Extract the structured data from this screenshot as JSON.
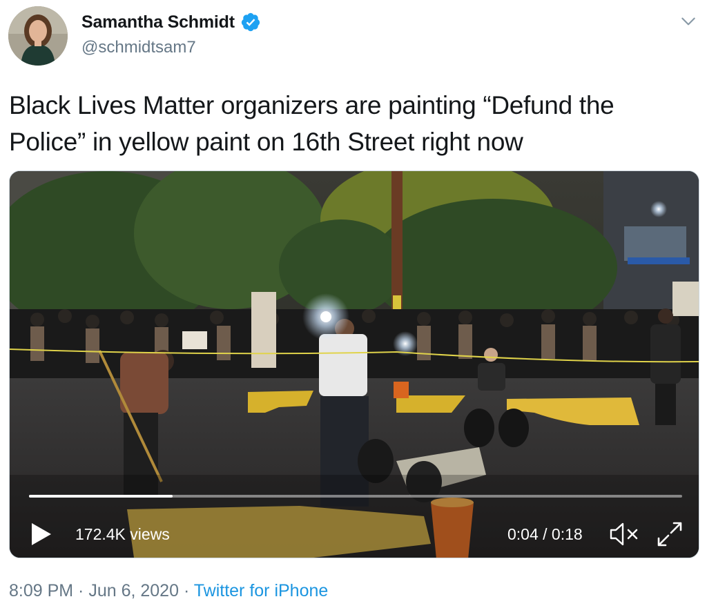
{
  "user": {
    "display_name": "Samantha Schmidt",
    "handle": "@schmidtsam7",
    "verified_icon": "verified-badge-icon",
    "avatar_icon": "profile-photo"
  },
  "tweet": {
    "text": "Black Lives Matter organizers are painting “Defund the Police” in yellow paint on 16th Street right now"
  },
  "video": {
    "views": "172.4K views",
    "time": "0:04 / 0:18",
    "progress": 0.22,
    "play_icon": "play-icon",
    "mute_icon": "muted-speaker-icon",
    "fullscreen_icon": "fullscreen-icon"
  },
  "meta": {
    "time": "8:09 PM",
    "separator": " · ",
    "date": "Jun 6, 2020",
    "source": "Twitter for iPhone"
  },
  "colors": {
    "link": "#1b95e0",
    "muted": "#657786",
    "text": "#14171a",
    "verified": "#1da1f2"
  }
}
